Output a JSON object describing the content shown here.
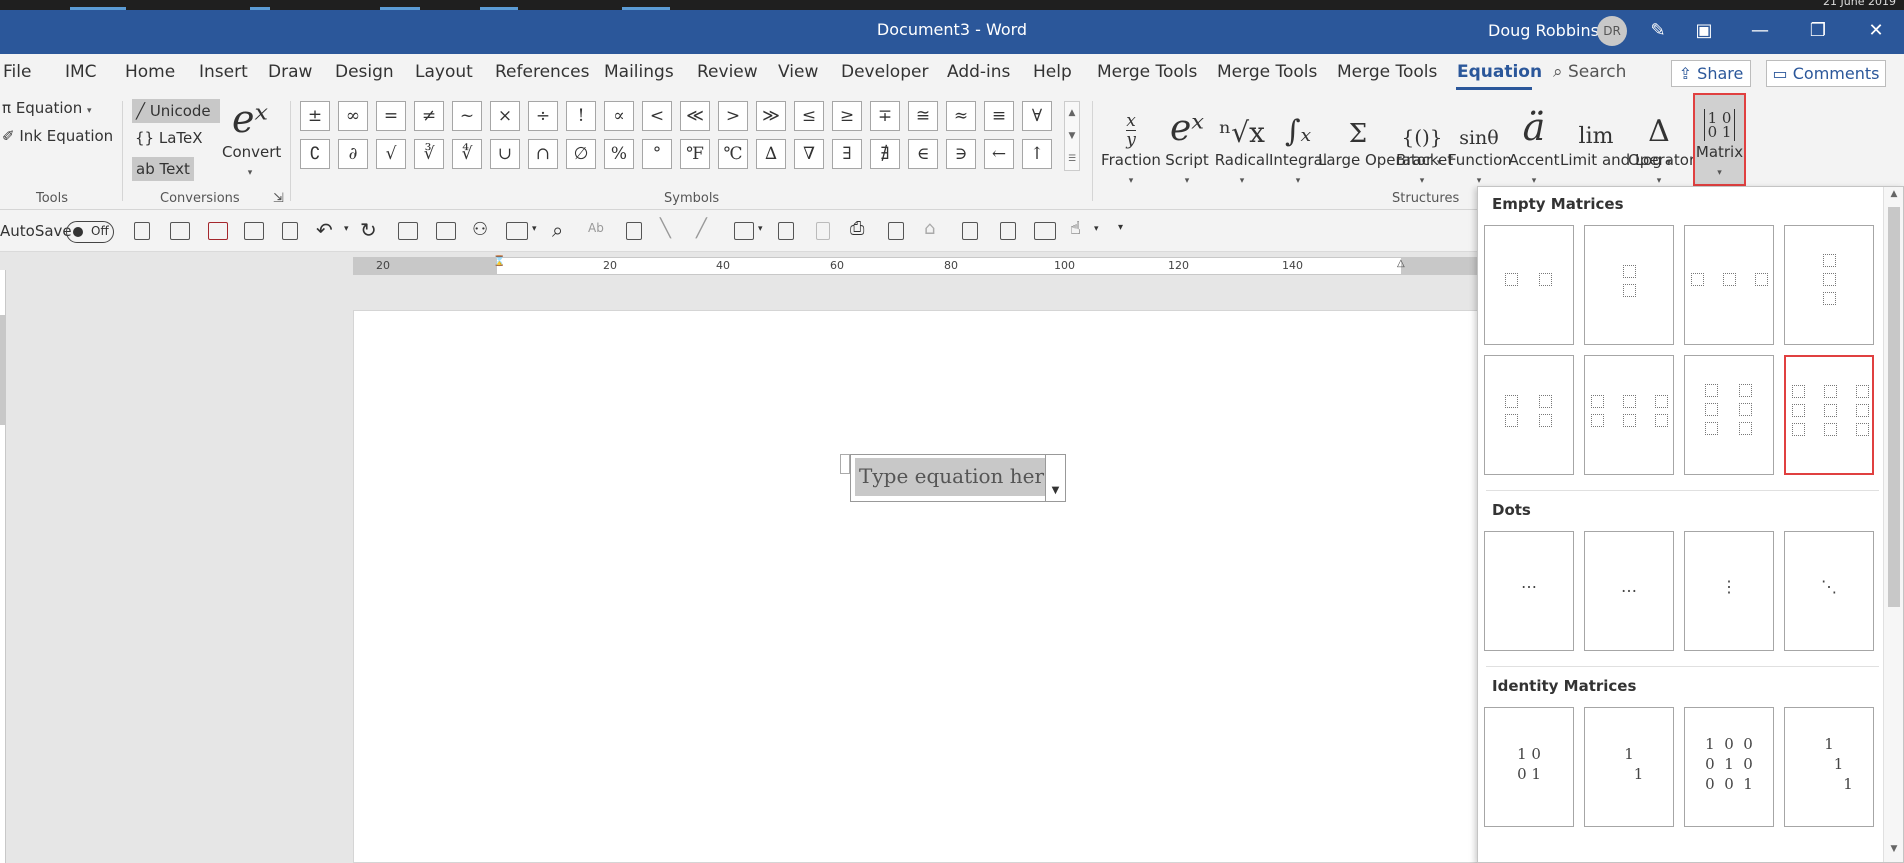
{
  "window": {
    "title": "Document3  -  Word",
    "user": "Doug Robbins",
    "initials": "DR",
    "date": "21 June 2019",
    "min": "—",
    "max": "❐",
    "close": "✕"
  },
  "menu": {
    "tabs": [
      "File",
      "IMC",
      "Home",
      "Insert",
      "Draw",
      "Design",
      "Layout",
      "References",
      "Mailings",
      "Review",
      "View",
      "Developer",
      "Add-ins",
      "Help",
      "Merge Tools",
      "Merge Tools",
      "Merge Tools",
      "Equation"
    ],
    "search": "Search",
    "share": "Share",
    "comments": "Comments"
  },
  "tools": {
    "equation": "Equation",
    "ink": "Ink Equation",
    "group": "Tools"
  },
  "conversions": {
    "unicode": "Unicode",
    "latex": "LaTeX",
    "text": "Text",
    "convert": "Convert",
    "group": "Conversions"
  },
  "symbols": {
    "group": "Symbols",
    "row1": [
      "±",
      "∞",
      "=",
      "≠",
      "~",
      "×",
      "÷",
      "!",
      "∝",
      "<",
      "≪",
      ">",
      "≫",
      "≤",
      "≥",
      "∓",
      "≅",
      "≈",
      "≡",
      "∀"
    ],
    "row2": [
      "∁",
      "∂",
      "√",
      "∛",
      "∜",
      "∪",
      "∩",
      "∅",
      "%",
      "°",
      "℉",
      "℃",
      "∆",
      "∇",
      "∃",
      "∄",
      "∈",
      "∋",
      "←",
      "↑"
    ]
  },
  "structures": {
    "group": "Structures",
    "items": [
      {
        "label": "Fraction",
        "glyph": "x/y"
      },
      {
        "label": "Script",
        "glyph": "eˣ"
      },
      {
        "label": "Radical",
        "glyph": "ⁿ√x"
      },
      {
        "label": "Integral",
        "glyph": "∫ₓ"
      },
      {
        "label": "Large Operator",
        "glyph": "Σ"
      },
      {
        "label": "Bracket",
        "glyph": "{()}"
      },
      {
        "label": "Function",
        "glyph": "sinθ"
      },
      {
        "label": "Accent",
        "glyph": "ä"
      },
      {
        "label": "Limit and Log",
        "glyph": "lim"
      },
      {
        "label": "Operator",
        "glyph": "Δ"
      },
      {
        "label": "Matrix",
        "glyph": "[1 0 / 0 1]"
      }
    ]
  },
  "qat": {
    "autosave": "AutoSave",
    "toggle": "Off"
  },
  "ruler": {
    "labels": [
      "20",
      "20",
      "40",
      "60",
      "80",
      "100",
      "120",
      "140"
    ]
  },
  "document": {
    "placeholder": "Type equation here."
  },
  "gallery": {
    "sections": [
      {
        "title": "Empty Matrices",
        "items": [
          "1x2 Empty Matrix",
          "2x1 Empty Matrix",
          "1x3 Empty Matrix",
          "3x1 Empty Matrix",
          "2x2 Empty Matrix",
          "2x3 Empty Matrix",
          "3x2 Empty Matrix",
          "3x3 Empty Matrix"
        ]
      },
      {
        "title": "Dots",
        "items": [
          "⋯",
          "…",
          "⋮",
          "⋱"
        ]
      },
      {
        "title": "Identity Matrices",
        "items": [
          "1 0\n0 1",
          "1\n    1",
          "1  0  0\n0  1  0\n0  0  1",
          "1\n    1\n        1"
        ]
      }
    ]
  }
}
